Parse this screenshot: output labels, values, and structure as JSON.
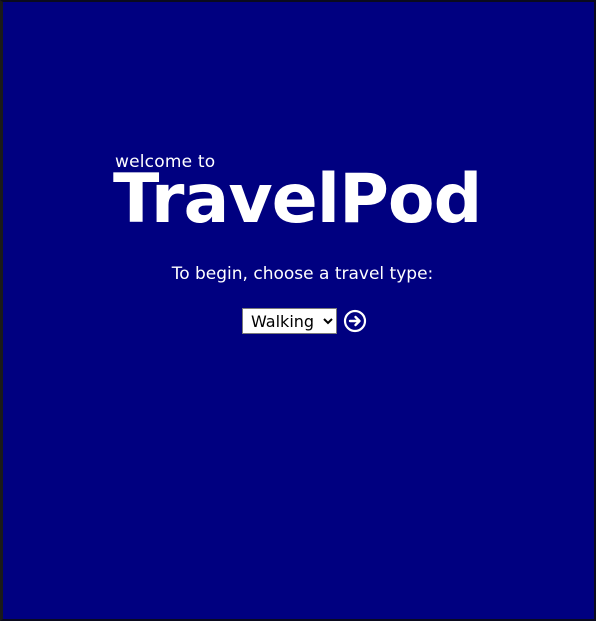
{
  "app": {
    "welcome_text": "welcome to",
    "brand_name": "TravelPod"
  },
  "main": {
    "prompt": "To begin, choose a travel type:",
    "travel_select": {
      "selected": "Walking",
      "options": [
        "Walking"
      ]
    },
    "go_icon": "arrow-right-circle-icon"
  },
  "colors": {
    "background": "#000080",
    "text": "#ffffff"
  }
}
